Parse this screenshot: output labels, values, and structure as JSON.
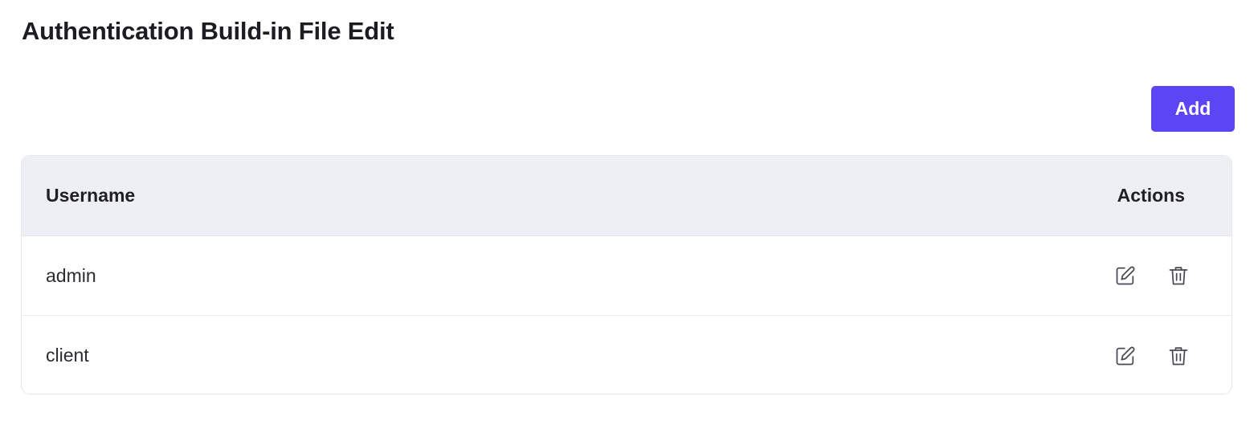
{
  "page": {
    "title": "Authentication Build-in File Edit"
  },
  "toolbar": {
    "add_label": "Add"
  },
  "table": {
    "columns": {
      "username": "Username",
      "actions": "Actions"
    },
    "rows": [
      {
        "username": "admin",
        "actions": [
          "edit-icon",
          "trash-icon"
        ]
      },
      {
        "username": "client",
        "actions": [
          "edit-icon",
          "trash-icon"
        ]
      }
    ]
  },
  "colors": {
    "accent": "#5b45f5",
    "header_bg": "#eeeff4",
    "border": "#e6e7ec"
  }
}
